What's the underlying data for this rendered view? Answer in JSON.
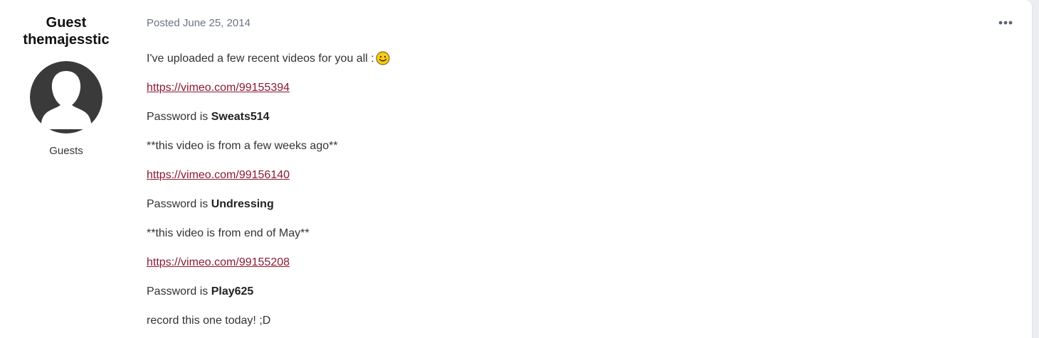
{
  "author": {
    "line1": "Guest",
    "line2": "themajesstic",
    "group": "Guests"
  },
  "post": {
    "date": "Posted June 25, 2014",
    "lines": [
      {
        "text": "I've uploaded a few recent videos for you all  :"
      },
      {
        "link": "https://vimeo.com/99155394"
      },
      {
        "prefix": "Password is ",
        "bold": "Sweats514"
      },
      {
        "text": "**this video is from a few weeks ago**"
      },
      {
        "link": "https://vimeo.com/99156140"
      },
      {
        "prefix": "Password is ",
        "bold": "Undressing"
      },
      {
        "text": "**this video is from end of May**"
      },
      {
        "link": "https://vimeo.com/99155208"
      },
      {
        "prefix": "Password is ",
        "bold": "Play625"
      },
      {
        "text": "record this one today! ;D"
      }
    ]
  },
  "icons": {
    "smiley": "smiley-icon",
    "more": "more-options-icon"
  },
  "colors": {
    "link": "#8b1a33",
    "meta": "#6a7484",
    "avatar": "#3a3a3a"
  }
}
